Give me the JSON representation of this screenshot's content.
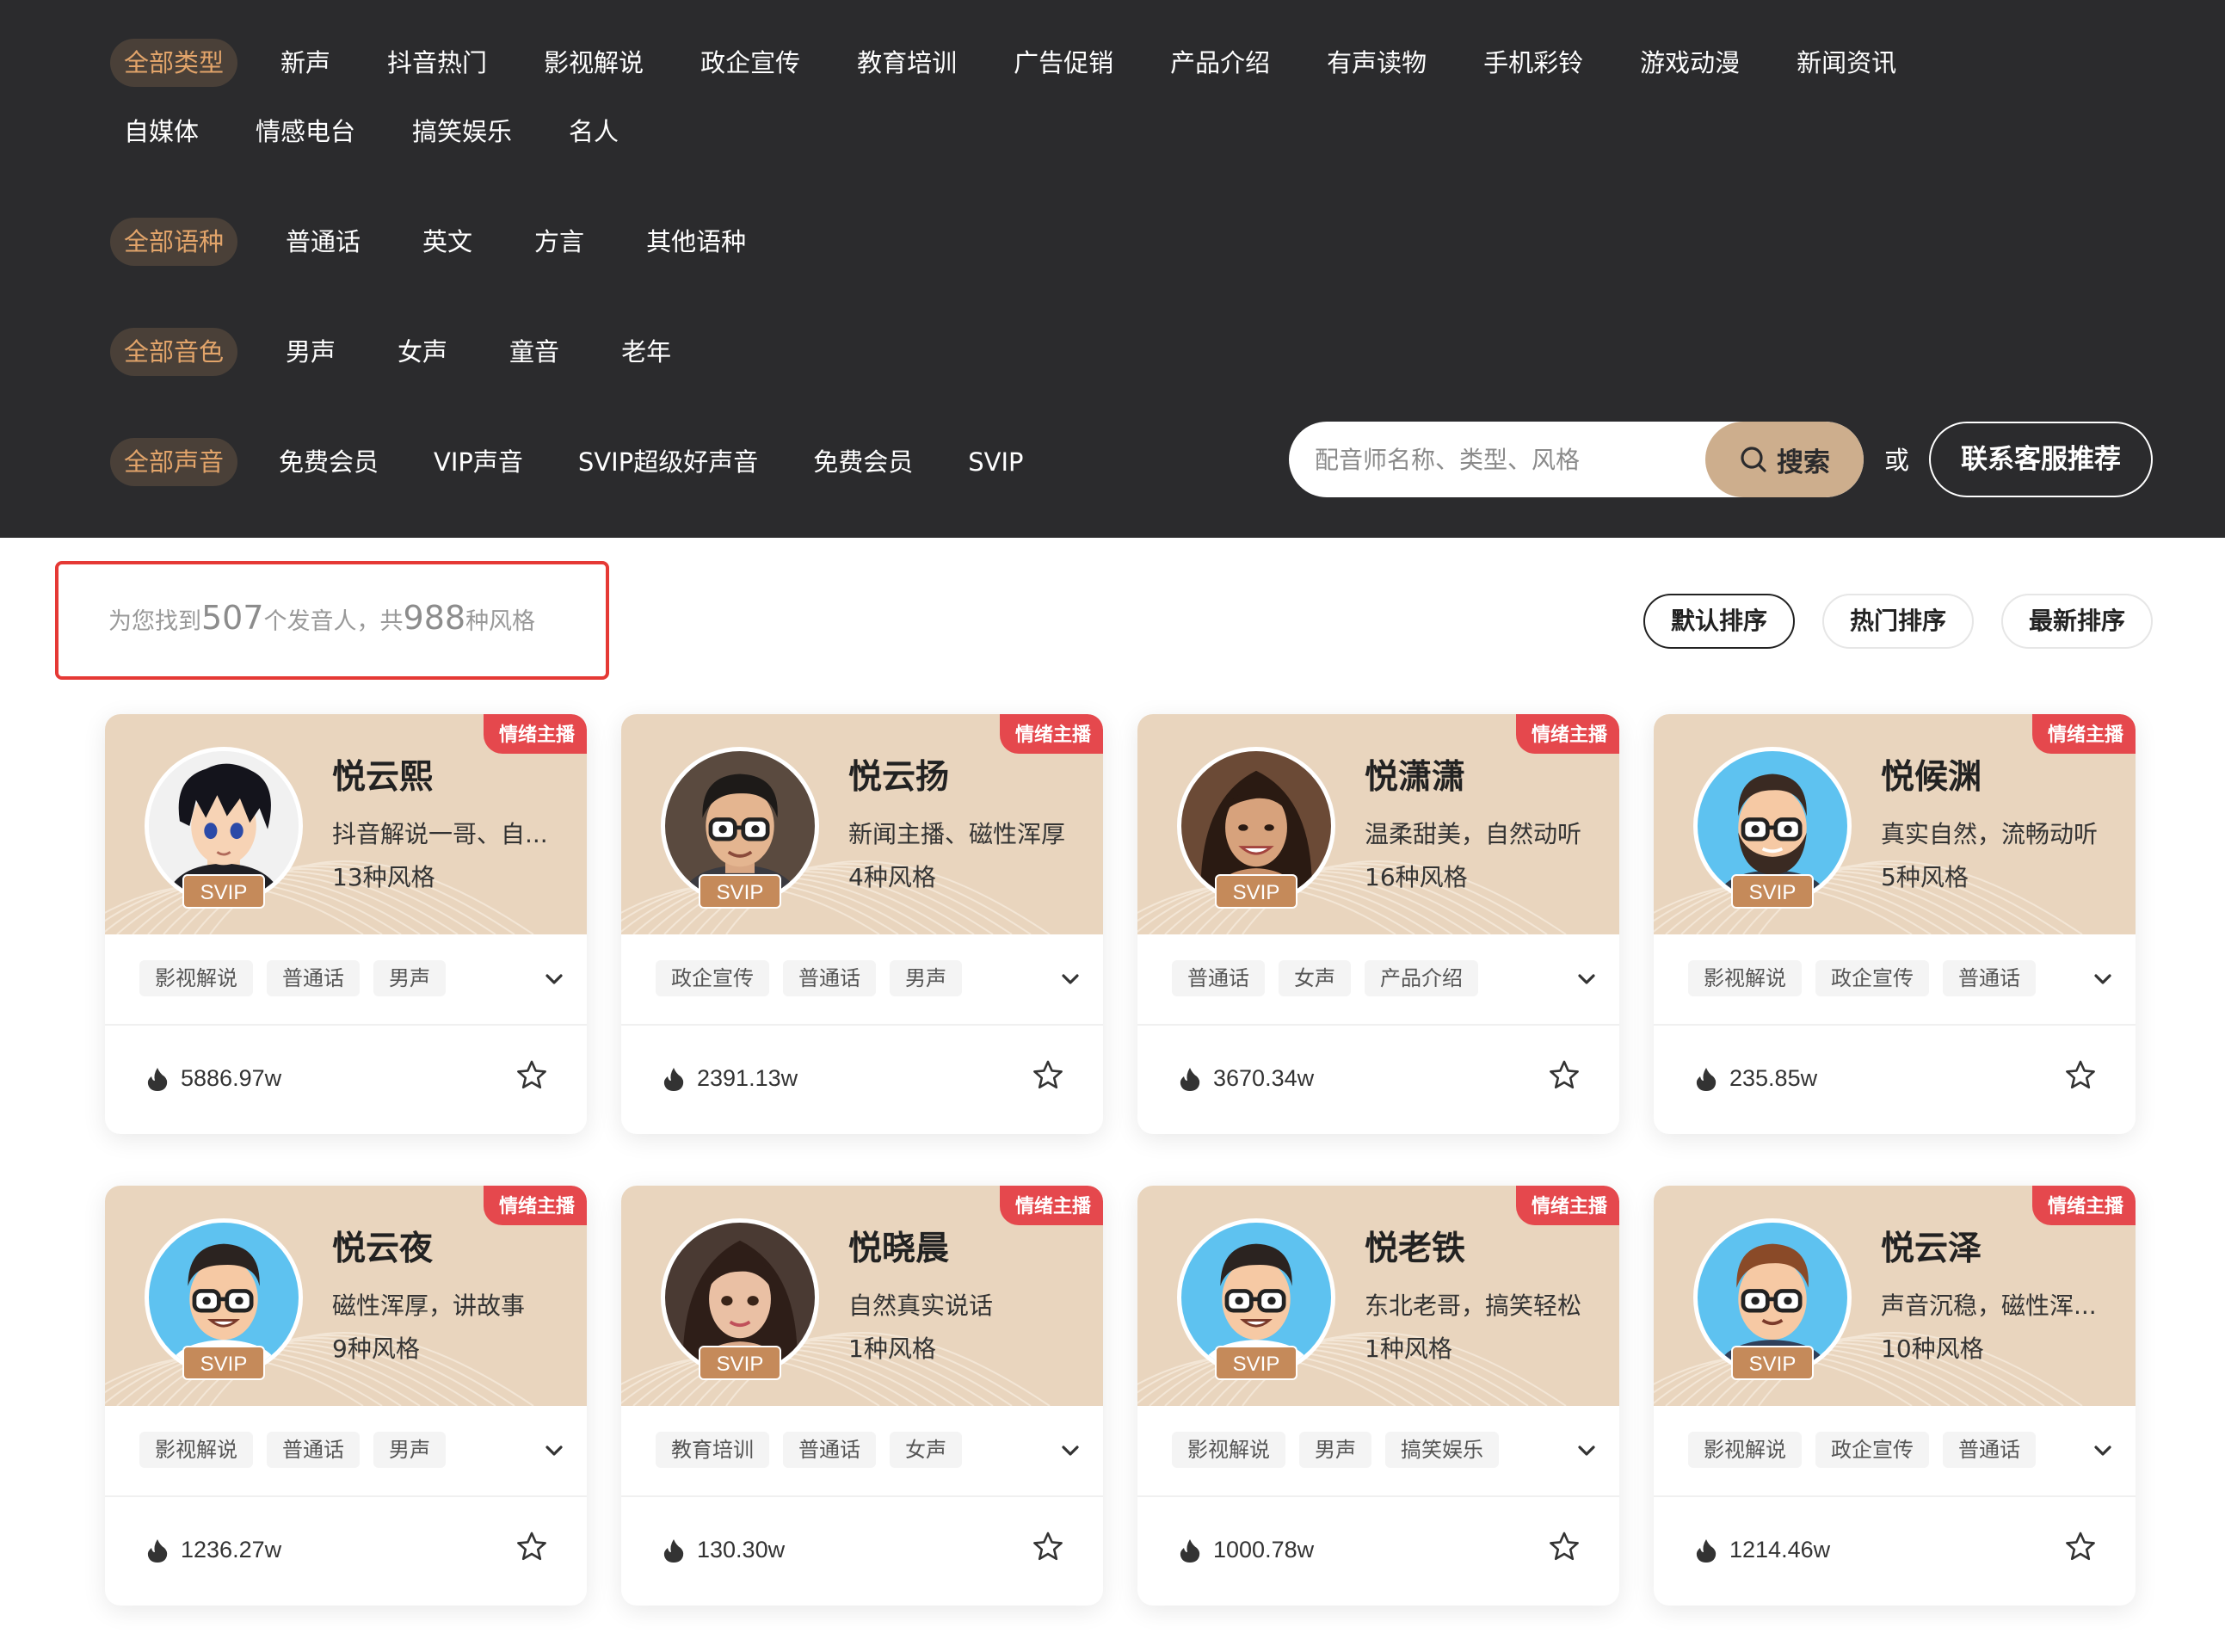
{
  "filters": {
    "types": [
      "全部类型",
      "新声",
      "抖音热门",
      "影视解说",
      "政企宣传",
      "教育培训",
      "广告促销",
      "产品介绍",
      "有声读物",
      "手机彩铃",
      "游戏动漫",
      "新闻资讯",
      "自媒体",
      "情感电台",
      "搞笑娱乐",
      "名人"
    ],
    "languages": [
      "全部语种",
      "普通话",
      "英文",
      "方言",
      "其他语种"
    ],
    "timbres": [
      "全部音色",
      "男声",
      "女声",
      "童音",
      "老年"
    ],
    "voices": [
      "全部声音",
      "免费会员",
      "VIP声音",
      "SVIP超级好声音",
      "免费会员",
      "SVIP"
    ]
  },
  "search": {
    "placeholder": "配音师名称、类型、风格",
    "button": "搜索",
    "or": "或",
    "contact": "联系客服推荐"
  },
  "result": {
    "prefix": "为您找到",
    "speakers": "507",
    "middle": "个发音人，共",
    "styles": "988",
    "suffix": "种风格"
  },
  "sort": [
    "默认排序",
    "热门排序",
    "最新排序"
  ],
  "colors": {
    "panel_bg": "#2b2b2d",
    "active_chip": "#e2a46a",
    "card_header": "#e9d5be",
    "badge": "#e5484d",
    "search_button": "#cdae8d"
  },
  "cards": [
    {
      "name": "悦云熙",
      "badge": "情绪主播",
      "desc": "抖音解说一哥、自...",
      "styles": "13种风格",
      "level": "SVIP",
      "tags": [
        "影视解说",
        "普通话",
        "男声"
      ],
      "heat": "5886.97w",
      "avatar": "anime-boy"
    },
    {
      "name": "悦云扬",
      "badge": "情绪主播",
      "desc": "新闻主播、磁性浑厚",
      "styles": "4种风格",
      "level": "SVIP",
      "tags": [
        "政企宣传",
        "普通话",
        "男声"
      ],
      "heat": "2391.13w",
      "avatar": "young-man-glasses"
    },
    {
      "name": "悦潇潇",
      "badge": "情绪主播",
      "desc": "温柔甜美，自然动听",
      "styles": "16种风格",
      "level": "SVIP",
      "tags": [
        "普通话",
        "女声",
        "产品介绍"
      ],
      "heat": "3670.34w",
      "avatar": "smiling-woman"
    },
    {
      "name": "悦候渊",
      "badge": "情绪主播",
      "desc": "真实自然，流畅动听",
      "styles": "5种风格",
      "level": "SVIP",
      "tags": [
        "影视解说",
        "政企宣传",
        "普通话"
      ],
      "heat": "235.85w",
      "avatar": "bearded-man-cartoon"
    },
    {
      "name": "悦云夜",
      "badge": "情绪主播",
      "desc": "磁性浑厚，讲故事",
      "styles": "9种风格",
      "level": "SVIP",
      "tags": [
        "影视解说",
        "普通话",
        "男声"
      ],
      "heat": "1236.27w",
      "avatar": "cartoon-man-glasses"
    },
    {
      "name": "悦晓晨",
      "badge": "情绪主播",
      "desc": "自然真实说话",
      "styles": "1种风格",
      "level": "SVIP",
      "tags": [
        "教育培训",
        "普通话",
        "女声"
      ],
      "heat": "130.30w",
      "avatar": "young-woman"
    },
    {
      "name": "悦老铁",
      "badge": "情绪主播",
      "desc": "东北老哥，搞笑轻松",
      "styles": "1种风格",
      "level": "SVIP",
      "tags": [
        "影视解说",
        "男声",
        "搞笑娱乐"
      ],
      "heat": "1000.78w",
      "avatar": "cartoon-man-glasses"
    },
    {
      "name": "悦云泽",
      "badge": "情绪主播",
      "desc": "声音沉稳，磁性浑...",
      "styles": "10种风格",
      "level": "SVIP",
      "tags": [
        "影视解说",
        "政企宣传",
        "普通话"
      ],
      "heat": "1214.46w",
      "avatar": "cartoon-man-brown-hair"
    }
  ]
}
